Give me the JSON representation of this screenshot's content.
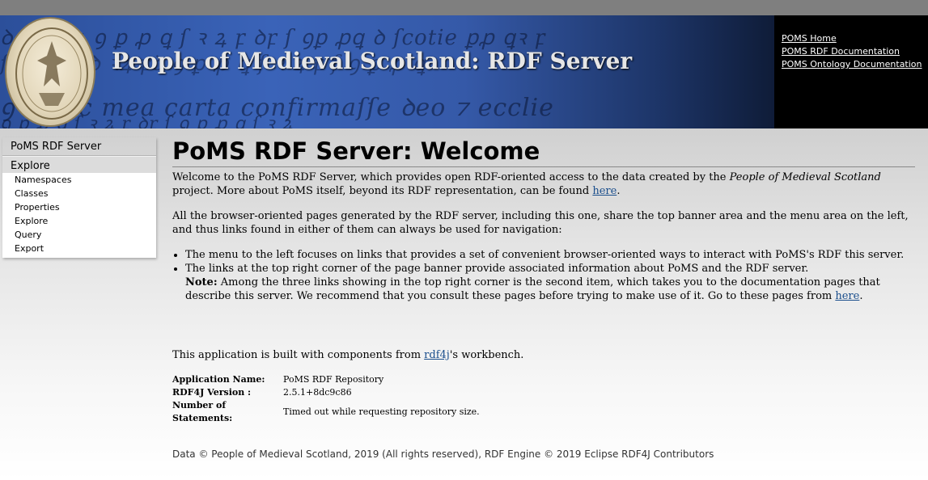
{
  "banner": {
    "title": "People of Medieval Scotland: RDF Server",
    "links": [
      "POMS Home",
      "POMS RDF Documentation",
      "POMS Ontology Documentation"
    ]
  },
  "sidebar": {
    "header": "PoMS RDF Server",
    "section": "Explore",
    "items": [
      "Namespaces",
      "Classes",
      "Properties",
      "Explore",
      "Query",
      "Export"
    ]
  },
  "main": {
    "title": "PoMS RDF Server: Welcome",
    "p1_a": "Welcome to the PoMS RDF Server, which provides open RDF-oriented access to the data created by the ",
    "p1_em": "People of Medieval Scotland",
    "p1_b": " project. More about PoMS itself, beyond its RDF representation, can be found ",
    "p1_link": "here",
    "p1_end": ".",
    "p2": "All the browser-oriented pages generated by the RDF server, including this one, share the top banner area and the menu area on the left, and thus links found in either of them can always be used for navigation:",
    "bullet1": "The menu to the left focuses on links that provides a set of convenient browser-oriented ways to interact with PoMS's RDF this server.",
    "bullet2": "The links at the top right corner of the page banner provide associated information about PoMS and the RDF server.",
    "note_label": "Note:",
    "note_text": " Among the three links showing in the top right corner is the second item, which takes you to the documentation pages that describe this server. We recommend that you consult these pages before trying to make use of it. Go to these pages from ",
    "note_link": "here",
    "note_end": ".",
    "built_a": "This application is built with components from ",
    "built_link": "rdf4j",
    "built_b": "'s workbench.",
    "info": [
      {
        "key": "Application Name:",
        "value": "PoMS RDF Repository"
      },
      {
        "key": "RDF4J Version :",
        "value": "2.5.1+8dc9c86"
      },
      {
        "key": "Number of Statements:",
        "value": "Timed out while requesting repository size."
      }
    ],
    "footer": "Data © People of Medieval Scotland, 2019 (All rights reserved), RDF Engine © 2019 Eclipse RDF4J Contributors"
  }
}
